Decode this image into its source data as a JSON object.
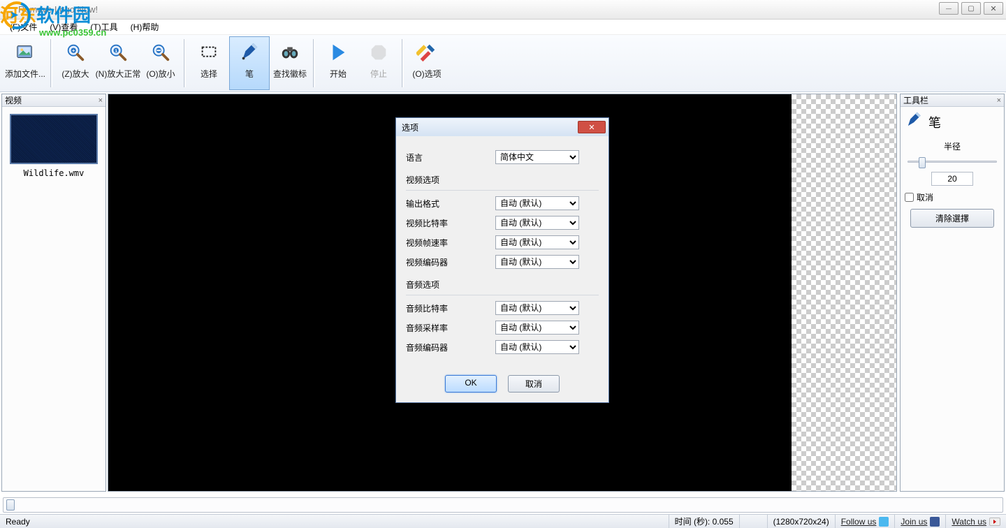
{
  "window": {
    "title": "Remove Logo Now!"
  },
  "watermark": {
    "zh": "河东软件园",
    "url": "www.pc0359.cn"
  },
  "menu": {
    "file": "(F)文件",
    "view": "(V)查看",
    "tools": "(T)工具",
    "help": "(H)帮助"
  },
  "toolbar": {
    "add_files": "添加文件...",
    "zoom_in": "(Z)放大",
    "zoom_normal": "(N)放大正常",
    "zoom_out": "(O)放小",
    "select": "选择",
    "pen": "笔",
    "find_logo": "查找徽标",
    "start": "开始",
    "stop": "停止",
    "options": "(O)选项"
  },
  "left_panel": {
    "title": "视频",
    "thumb_name": "Wildlife.wmv"
  },
  "right_panel": {
    "title": "工具栏",
    "pen": "笔",
    "radius_label": "半径",
    "radius_value": "20",
    "cancel_checkbox": "取消",
    "clear_selection": "清除選擇"
  },
  "dialog": {
    "title": "选项",
    "language_label": "语言",
    "language_value": "简体中文",
    "video_section": "视频选项",
    "output_format": "输出格式",
    "video_bitrate": "视频比特率",
    "video_framerate": "视频帧速率",
    "video_encoder": "视频编码器",
    "audio_section": "音频选项",
    "audio_bitrate": "音频比特率",
    "audio_samplerate": "音频采样率",
    "audio_encoder": "音频编码器",
    "auto_default": "自动 (默认)",
    "ok": "OK",
    "cancel": "取消"
  },
  "status": {
    "ready": "Ready",
    "time_label": "时间 (秒): 0.055",
    "resolution": "(1280x720x24)",
    "follow": "Follow us",
    "join": "Join us",
    "watch": "Watch us"
  }
}
